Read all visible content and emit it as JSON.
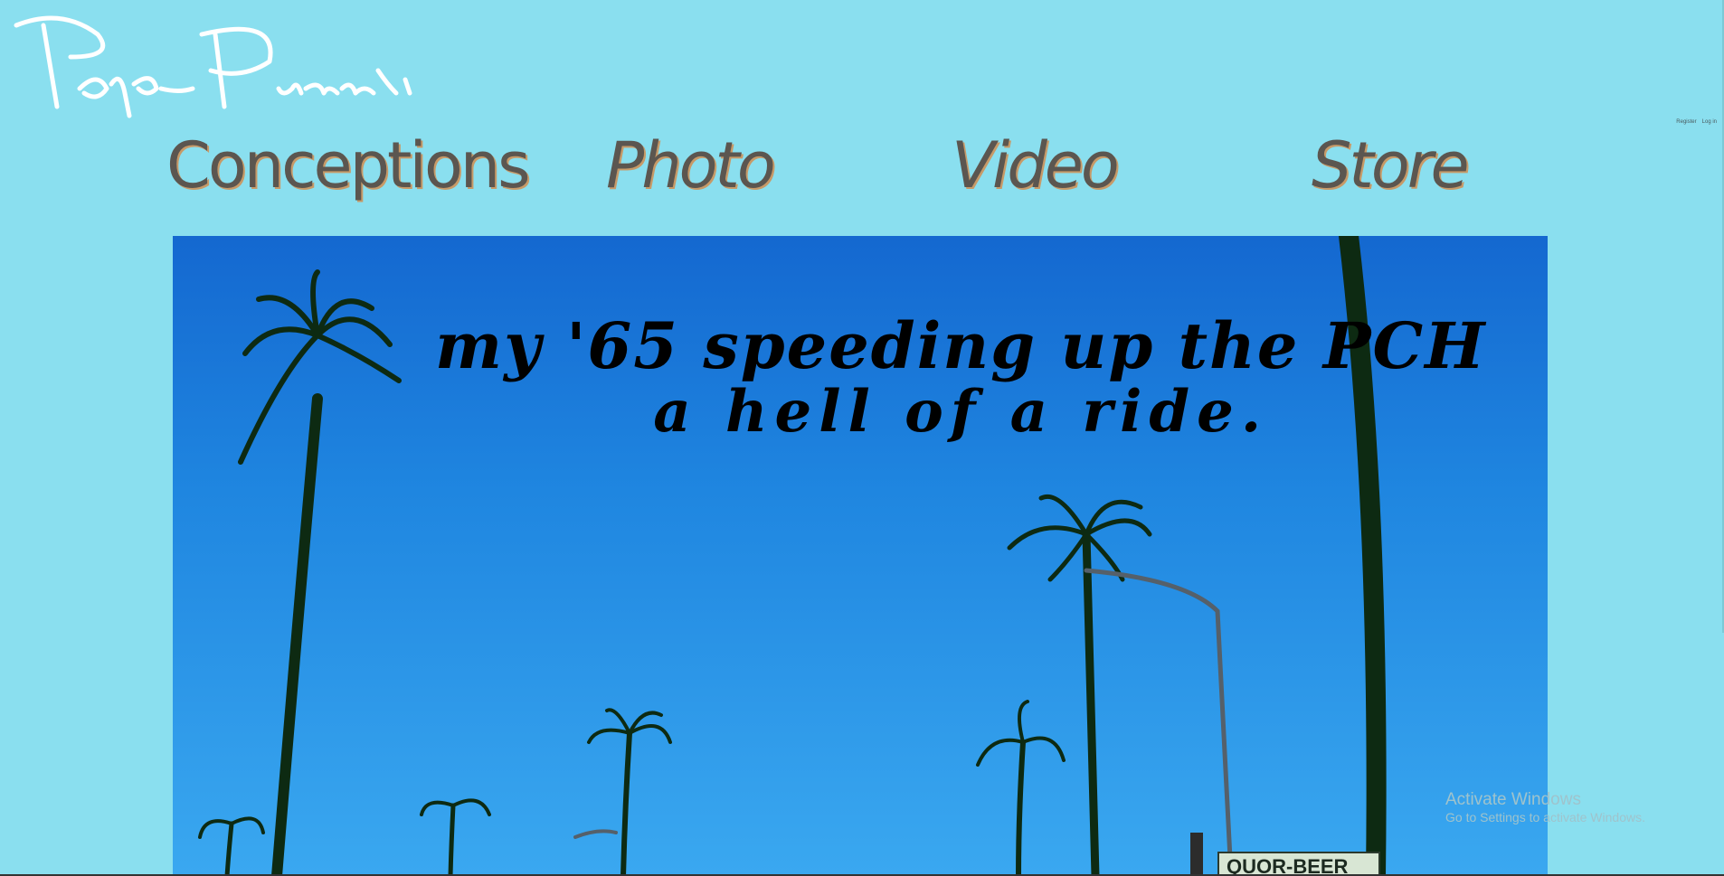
{
  "site": {
    "logo_alt": "PapaPuzeski",
    "logo_text": "Papa Puzeski"
  },
  "auth": {
    "register_label": "Register",
    "login_label": "Log in"
  },
  "nav": {
    "items": [
      {
        "label": "Conceptions"
      },
      {
        "label": "Photo"
      },
      {
        "label": "Video"
      },
      {
        "label": "Store"
      }
    ]
  },
  "hero": {
    "caption_line1": "my '65 speeding up the PCH",
    "caption_line2": "a hell of a ride.",
    "sign_text": "QUOR-BEER",
    "sky_color": "#1f86e0"
  },
  "os_overlay": {
    "title": "Activate Windows",
    "subtitle": "Go to Settings to activate Windows."
  },
  "colors": {
    "background": "#8adfef",
    "nav_text": "#5b5650",
    "nav_shadow": "#c79a68"
  }
}
